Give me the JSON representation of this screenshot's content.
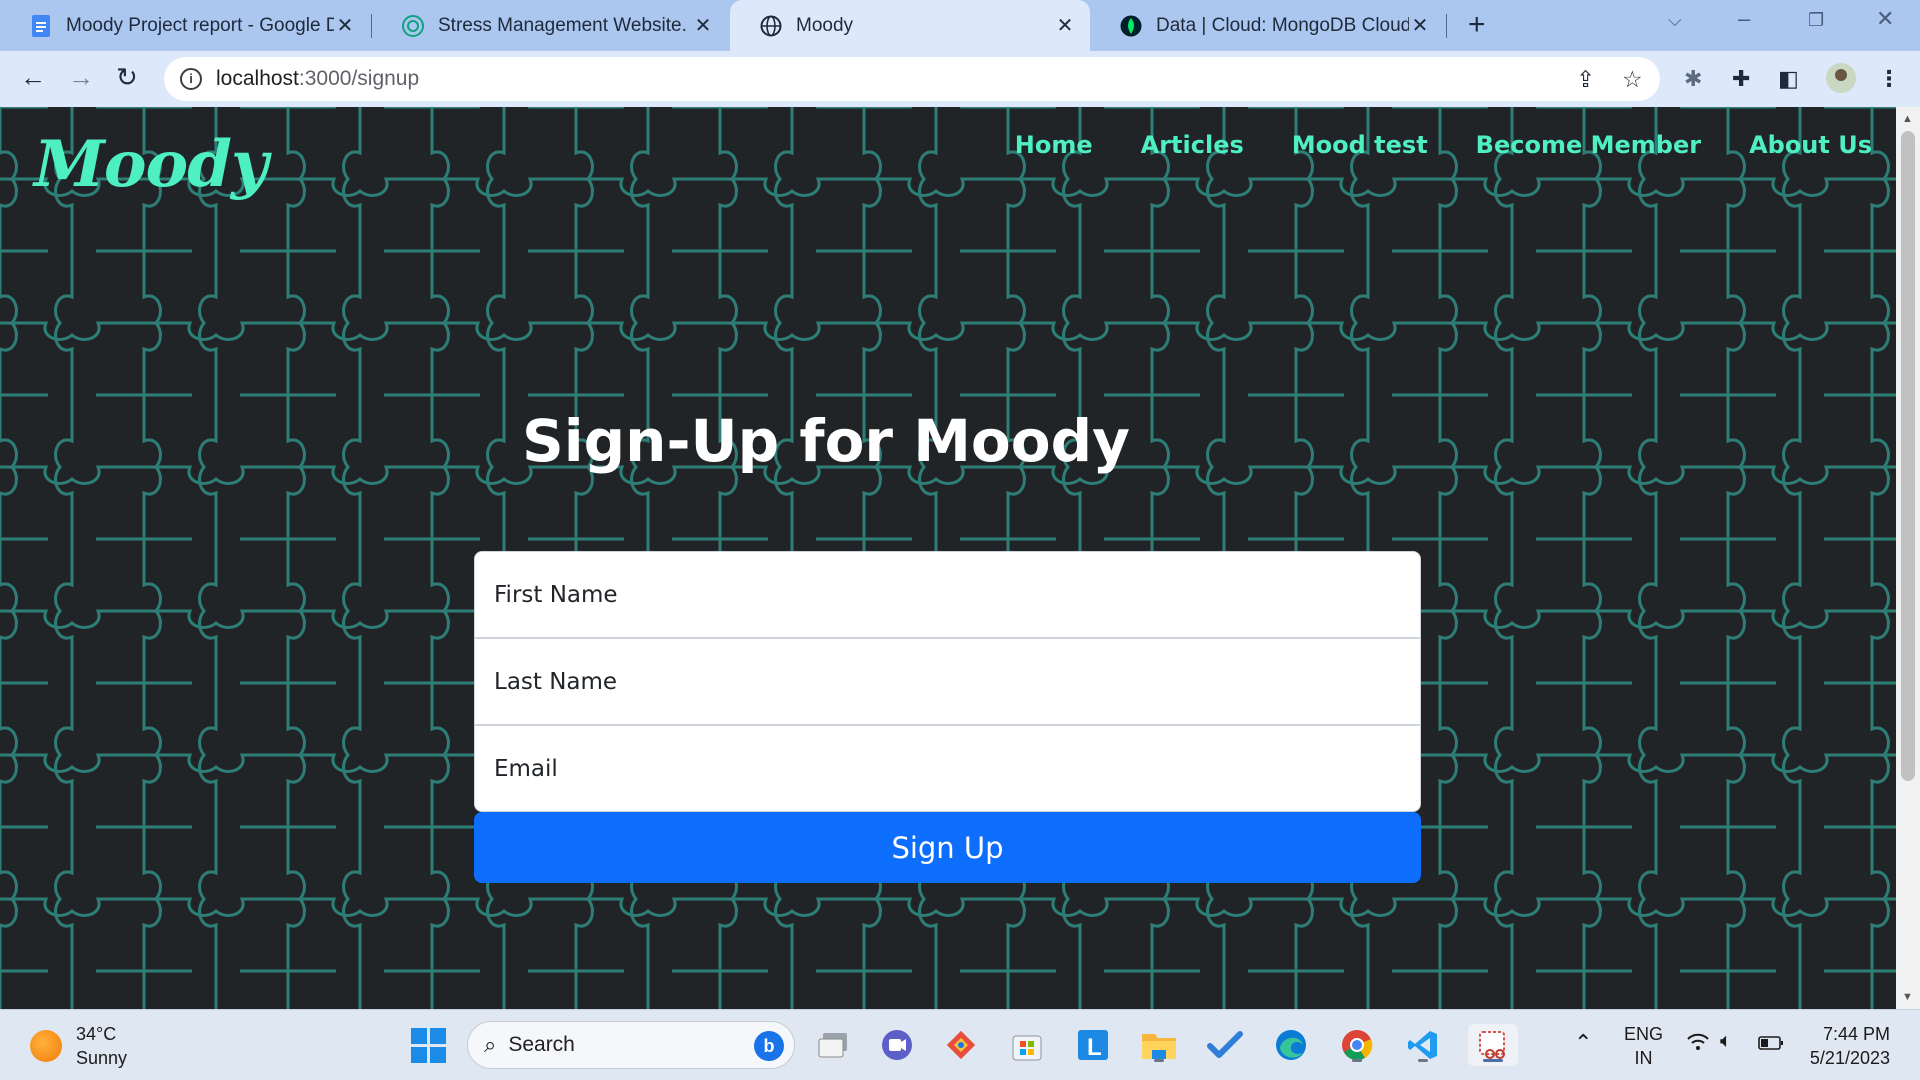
{
  "browser": {
    "tabs": [
      {
        "title": "Moody Project report - Google D",
        "icon": "google-docs-icon",
        "active": false
      },
      {
        "title": "Stress Management Website.",
        "icon": "chatgpt-icon",
        "active": false
      },
      {
        "title": "Moody",
        "icon": "globe-icon",
        "active": true
      },
      {
        "title": "Data | Cloud: MongoDB Cloud",
        "icon": "mongodb-leaf-icon",
        "active": false
      }
    ],
    "new_tab": "+",
    "url_host": "localhost",
    "url_path": ":3000/signup"
  },
  "site": {
    "logo": "Moody",
    "nav": [
      "Home",
      "Articles",
      "Mood test",
      "Become Member",
      "About Us"
    ],
    "heading": "Sign-Up for Moody",
    "form": {
      "first_name_placeholder": "First Name",
      "last_name_placeholder": "Last Name",
      "email_placeholder": "Email",
      "submit_label": "Sign Up"
    },
    "colors": {
      "accent": "#4ef0c2",
      "background": "#212427",
      "pattern": "#2e7e78",
      "button": "#0d6efd"
    }
  },
  "taskbar": {
    "weather_temp": "34°C",
    "weather_desc": "Sunny",
    "search_label": "Search",
    "language_line1": "ENG",
    "language_line2": "IN",
    "time": "7:44 PM",
    "date": "5/21/2023"
  }
}
